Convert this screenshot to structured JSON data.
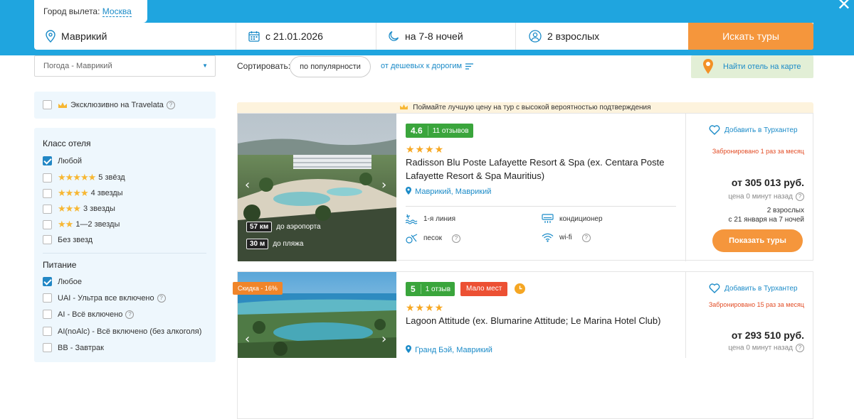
{
  "search": {
    "departure_label": "Город вылета:",
    "departure_city": "Москва",
    "destination": "Маврикий",
    "date": "с 21.01.2026",
    "nights": "на 7-8 ночей",
    "tourists": "2 взрослых",
    "button": "Искать туры"
  },
  "toolbar": {
    "weather": "Погода - Маврикий",
    "sort_label": "Сортировать:",
    "sort_value": "по популярности",
    "sort_order": "от дешевых к дорогим",
    "map_button": "Найти отель на карте"
  },
  "filters": {
    "exclusive": "Эксклюзивно на Travelata",
    "hotel_class_title": "Класс отеля",
    "hotel_class": [
      {
        "label": "Любой",
        "checked": true,
        "stars": 0
      },
      {
        "label": "5 звёзд",
        "checked": false,
        "stars": 5
      },
      {
        "label": "4 звезды",
        "checked": false,
        "stars": 4
      },
      {
        "label": "3 звезды",
        "checked": false,
        "stars": 3
      },
      {
        "label": "1—2 звезды",
        "checked": false,
        "stars": 2
      },
      {
        "label": "Без звезд",
        "checked": false,
        "stars": 0
      }
    ],
    "meal_title": "Питание",
    "meals": [
      {
        "label": "Любое",
        "checked": true,
        "help": false
      },
      {
        "label": "UAI - Ультра все включено",
        "checked": false,
        "help": true
      },
      {
        "label": "AI - Всё включено",
        "checked": false,
        "help": true
      },
      {
        "label": "AI(noAlc) - Всё включено (без алкоголя)",
        "checked": false,
        "help": false
      },
      {
        "label": "BB - Завтрак",
        "checked": false,
        "help": false
      }
    ]
  },
  "banner": "Поймайте лучшую цену на тур с высокой вероятностью подтверждения",
  "hotels": [
    {
      "rating": "4.6",
      "reviews": "11 отзывов",
      "stars": 4,
      "name": "Radisson Blu Poste Lafayette Resort & Spa (ex. Centara Poste Lafayette Resort & Spa Mauritius)",
      "location": "Маврикий, Маврикий",
      "airport_km": "57 км",
      "airport_label": "до аэропорта",
      "beach_m": "30 м",
      "beach_label": "до пляжа",
      "amenities": [
        "1-я линия",
        "кондиционер",
        "песок",
        "wi-fi"
      ],
      "wishlist": "Добавить в Турхантер",
      "booked": "Забронировано 1 раз за месяц",
      "price": "от 305 013 руб.",
      "price_age": "цена 0 минут назад",
      "pax": "2 взрослых",
      "dates": "с 21 января на 7 ночей",
      "button": "Показать туры"
    },
    {
      "discount": "Скидка - 16%",
      "rating": "5",
      "reviews": "1 отзыв",
      "few_places": "Мало мест",
      "stars": 4,
      "name": "Lagoon Attitude (ex. Blumarine Attitude; Le Marina Hotel Club)",
      "location": "Гранд Бэй, Маврикий",
      "wishlist": "Добавить в Турхантер",
      "booked": "Забронировано 15 раз за месяц",
      "price": "от 293 510 руб.",
      "price_age": "цена 0 минут назад"
    }
  ],
  "colors": {
    "accent": "#1fa5df",
    "button": "#f5963c",
    "rating": "#3aa53c",
    "link": "#1b8bc8"
  }
}
